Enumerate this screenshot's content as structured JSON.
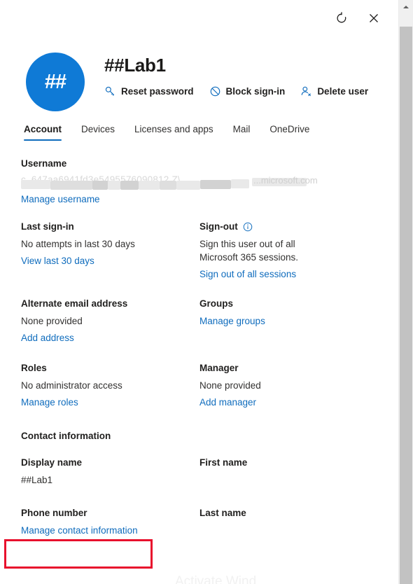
{
  "window": {
    "refresh_label": "Refresh",
    "close_label": "Close"
  },
  "header": {
    "avatar_initials": "##",
    "title": "##Lab1",
    "actions": [
      {
        "label": "Reset password",
        "icon": "key-icon"
      },
      {
        "label": "Block sign-in",
        "icon": "block-icon"
      },
      {
        "label": "Delete user",
        "icon": "person-delete-icon"
      }
    ]
  },
  "tabs": [
    {
      "label": "Account",
      "active": true
    },
    {
      "label": "Devices",
      "active": false
    },
    {
      "label": "Licenses and apps",
      "active": false
    },
    {
      "label": "Mail",
      "active": false
    },
    {
      "label": "OneDrive",
      "active": false
    }
  ],
  "account": {
    "username": {
      "label": "Username",
      "value_redacted": "",
      "value_tail": "...microsoft.com",
      "link": "Manage username"
    },
    "last_signin": {
      "label": "Last sign-in",
      "value": "No attempts in last 30 days",
      "link": "View last 30 days"
    },
    "signout": {
      "label": "Sign-out",
      "info_icon": "info-icon",
      "value": "Sign this user out of all Microsoft 365 sessions.",
      "link": "Sign out of all sessions"
    },
    "alternate_email": {
      "label": "Alternate email address",
      "value": "None provided",
      "link": "Add address"
    },
    "groups": {
      "label": "Groups",
      "link": "Manage groups"
    },
    "roles": {
      "label": "Roles",
      "value": "No administrator access",
      "link": "Manage roles"
    },
    "manager": {
      "label": "Manager",
      "value": "None provided",
      "link": "Add manager"
    }
  },
  "contact_information": {
    "heading": "Contact information",
    "display_name": {
      "label": "Display name",
      "value": "##Lab1"
    },
    "first_name": {
      "label": "First name",
      "value": ""
    },
    "phone_number": {
      "label": "Phone number",
      "value": ""
    },
    "last_name": {
      "label": "Last name",
      "value": ""
    },
    "link": "Manage contact information"
  },
  "watermark": {
    "text": "Activate Wind"
  },
  "colors": {
    "accent": "#0f6cbd",
    "avatar": "#0f7ad6",
    "annotation": "#e8112d",
    "text": "#201f1e",
    "muted": "#323130"
  }
}
